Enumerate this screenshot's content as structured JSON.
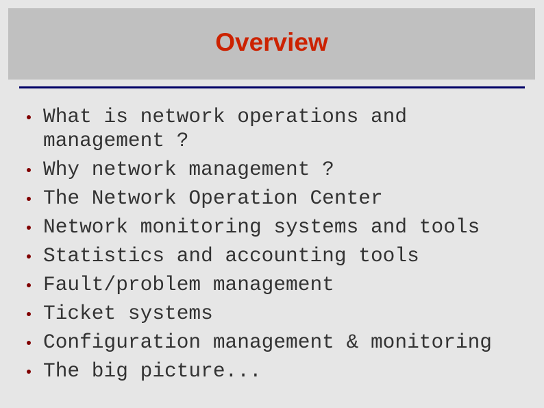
{
  "slide": {
    "title": "Overview",
    "colors": {
      "title": "#cc2200",
      "title_band": "#c0c0c0",
      "rule": "#000066",
      "bullet": "#800000",
      "text": "#333333",
      "background": "#e6e6e6"
    },
    "bullets": [
      {
        "text": "What is network operations and management ?"
      },
      {
        "text": "Why network management ?"
      },
      {
        "text": "The Network Operation Center"
      },
      {
        "text": "Network monitoring systems and tools"
      },
      {
        "text": "Statistics and accounting tools"
      },
      {
        "text": "Fault/problem management"
      },
      {
        "text": "Ticket systems"
      },
      {
        "text": "Configuration management & monitoring"
      },
      {
        "text": "The big picture..."
      }
    ]
  }
}
